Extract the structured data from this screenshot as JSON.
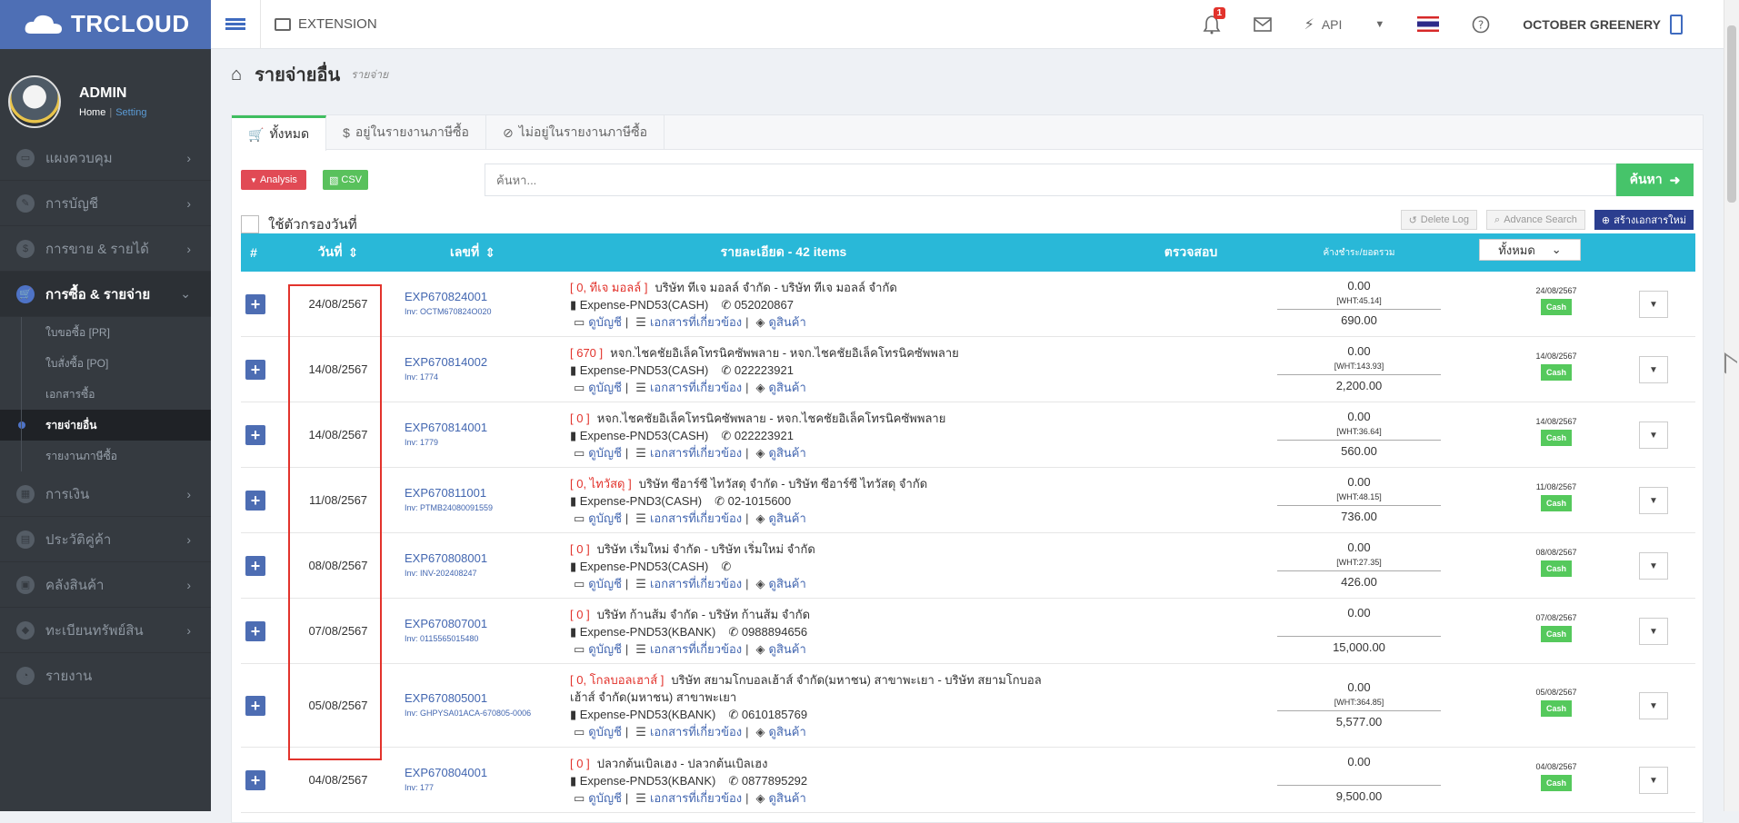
{
  "app": {
    "logo": "TRCLOUD",
    "extension": "EXTENSION",
    "notifications": "1",
    "api": "API",
    "company": "OCTOBER GREENERY"
  },
  "profile": {
    "name": "ADMIN",
    "home": "Home",
    "setting": "Setting"
  },
  "sidebar": {
    "items": [
      {
        "label": "แผงควบคุม"
      },
      {
        "label": "การบัญชี"
      },
      {
        "label": "การขาย & รายได้"
      },
      {
        "label": "การซื้อ & รายจ่าย"
      },
      {
        "label": "การเงิน"
      },
      {
        "label": "ประวัติคู่ค้า"
      },
      {
        "label": "คลังสินค้า"
      },
      {
        "label": "ทะเบียนทรัพย์สิน"
      },
      {
        "label": "รายงาน"
      }
    ],
    "subitems": [
      {
        "label": "ใบขอซื้อ [PR]"
      },
      {
        "label": "ใบสั่งซื้อ [PO]"
      },
      {
        "label": "เอกสารซื้อ"
      },
      {
        "label": "รายจ่ายอื่น"
      },
      {
        "label": "รายงานภาษีซื้อ"
      }
    ]
  },
  "page": {
    "title": "รายจ่ายอื่น",
    "subtitle": "รายจ่าย"
  },
  "tabs": [
    {
      "label": "ทั้งหมด"
    },
    {
      "label": "อยู่ในรายงานภาษีซื้อ"
    },
    {
      "label": "ไม่อยู่ในรายงานภาษีซื้อ"
    }
  ],
  "toolbar": {
    "analysis": "Analysis",
    "csv": "CSV",
    "search_placeholder": "ค้นหา...",
    "search_btn": "ค้นหา",
    "date_filter": "ใช้ตัวกรองวันที่",
    "delete_log": "Delete Log",
    "advance_search": "Advance Search",
    "create_new": "สร้างเอกสารใหม่"
  },
  "table": {
    "headers": {
      "hash": "#",
      "date": "วันที่",
      "docno": "เลขที่",
      "detail": "รายละเอียด - 42 items",
      "check": "ตรวจสอบ",
      "balance": "ค้างชำระ/ยอดรวม",
      "filter": "ทั้งหมด"
    },
    "rows": [
      {
        "date": "24/08/2567",
        "doc": "EXP670824001",
        "inv": "Inv: OCTM670824O020",
        "code": "[ 0, ทีเจ มอลล์ ]",
        "vendor": "บริษัท ทีเจ มอลล์ จำกัด - บริษัท ทีเจ มอลล์ จำกัด",
        "expense": "Expense-PND53(CASH)",
        "phone": "052020867",
        "balance": "0.00",
        "wht": "[WHT:45.14]",
        "total": "690.00",
        "paydate": "24/08/2567",
        "status": "Cash"
      },
      {
        "date": "14/08/2567",
        "doc": "EXP670814002",
        "inv": "Inv: 1774",
        "code": "[ 670 ]",
        "vendor": "หจก.ไชคชัยอิเล็คโทรนิคซัพพลาย - หจก.ไชคชัยอิเล็คโทรนิคซัพพลาย",
        "expense": "Expense-PND53(CASH)",
        "phone": "022223921",
        "balance": "0.00",
        "wht": "[WHT:143.93]",
        "total": "2,200.00",
        "paydate": "14/08/2567",
        "status": "Cash"
      },
      {
        "date": "14/08/2567",
        "doc": "EXP670814001",
        "inv": "Inv: 1779",
        "code": "[ 0 ]",
        "vendor": "หจก.ไชคชัยอิเล็คโทรนิคซัพพลาย - หจก.ไชคชัยอิเล็คโทรนิคซัพพลาย",
        "expense": "Expense-PND53(CASH)",
        "phone": "022223921",
        "balance": "0.00",
        "wht": "[WHT:36.64]",
        "total": "560.00",
        "paydate": "14/08/2567",
        "status": "Cash"
      },
      {
        "date": "11/08/2567",
        "doc": "EXP670811001",
        "inv": "Inv: PTMB24080091559",
        "code": "[ 0, ไทวัสดุ ]",
        "vendor": "บริษัท ซีอาร์ซี ไทวัสดุ จำกัด - บริษัท ซีอาร์ซี ไทวัสดุ จำกัด",
        "expense": "Expense-PND3(CASH)",
        "phone": "02-1015600",
        "balance": "0.00",
        "wht": "[WHT:48.15]",
        "total": "736.00",
        "paydate": "11/08/2567",
        "status": "Cash"
      },
      {
        "date": "08/08/2567",
        "doc": "EXP670808001",
        "inv": "Inv: INV-202408247",
        "code": "[ 0 ]",
        "vendor": "บริษัท เริ่มใหม่ จำกัด - บริษัท เริ่มใหม่ จำกัด",
        "expense": "Expense-PND53(CASH)",
        "phone": "",
        "balance": "0.00",
        "wht": "[WHT:27.35]",
        "total": "426.00",
        "paydate": "08/08/2567",
        "status": "Cash"
      },
      {
        "date": "07/08/2567",
        "doc": "EXP670807001",
        "inv": "Inv: 0115565015480",
        "code": "[ 0 ]",
        "vendor": "บริษัท ก้านส้ม จำกัด - บริษัท ก้านส้ม จำกัด",
        "expense": "Expense-PND53(KBANK)",
        "phone": "0988894656",
        "balance": "0.00",
        "wht": "",
        "total": "15,000.00",
        "paydate": "07/08/2567",
        "status": "Cash"
      },
      {
        "date": "05/08/2567",
        "doc": "EXP670805001",
        "inv": "Inv: GHPYSA01ACA-670805-0006",
        "code": "[ 0, โกลบอลเฮาส์ ]",
        "vendor": "บริษัท สยามโกบอลเฮ้าส์ จำกัด(มหาชน) สาขาพะเยา - บริษัท สยามโกบอลเฮ้าส์ จำกัด(มหาชน) สาขาพะเยา",
        "expense": "Expense-PND53(KBANK)",
        "phone": "0610185769",
        "balance": "0.00",
        "wht": "[WHT:364.85]",
        "total": "5,577.00",
        "paydate": "05/08/2567",
        "status": "Cash"
      },
      {
        "date": "04/08/2567",
        "doc": "EXP670804001",
        "inv": "Inv: 177",
        "code": "[ 0 ]",
        "vendor": "ปลวกต้นเบิลเฮง - ปลวกต้นเบิลเฮง",
        "expense": "Expense-PND53(KBANK)",
        "phone": "0877895292",
        "balance": "0.00",
        "wht": "",
        "total": "9,500.00",
        "paydate": "04/08/2567",
        "status": "Cash"
      }
    ],
    "links": {
      "account": "ดูบัญชี",
      "docs": "เอกสารที่เกี่ยวข้อง",
      "goods": "ดูสินค้า"
    }
  },
  "colors": {
    "brand": "#4e6fb5",
    "header": "#29b8d8",
    "danger": "#e2332c",
    "success": "#55c95c"
  }
}
